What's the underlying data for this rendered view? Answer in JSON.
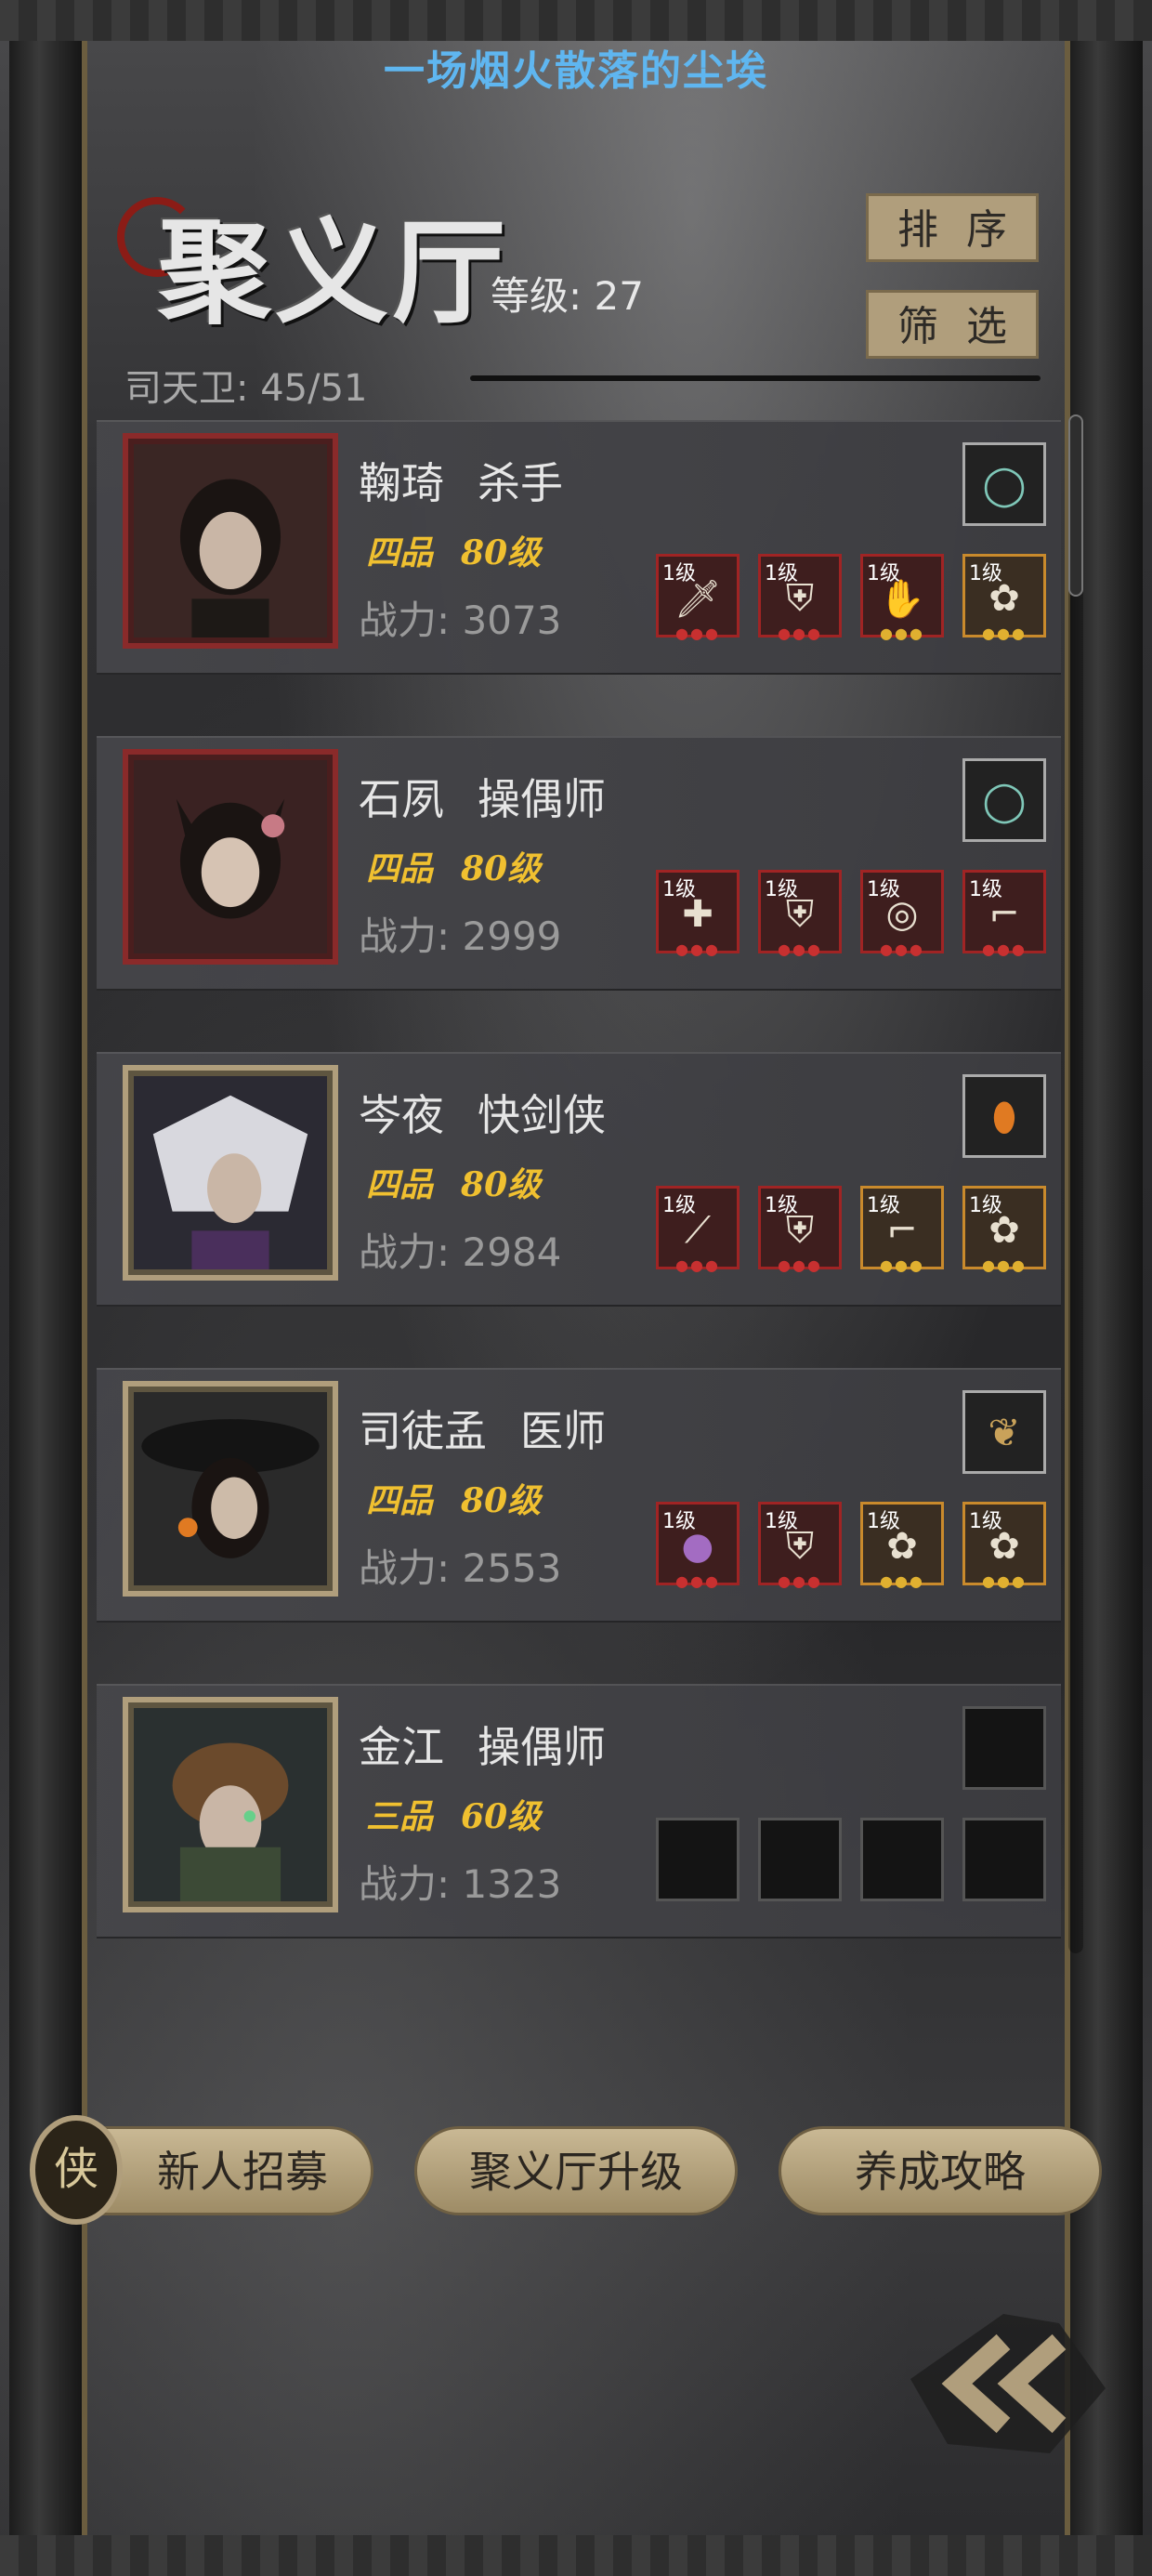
{
  "banner": "一场烟火散落的尘埃",
  "hall": {
    "title": "聚义厅",
    "level_text": "等级: 27",
    "guard_count": "司天卫: 45/51"
  },
  "buttons": {
    "sort": "排序",
    "filter": "筛选",
    "recruit": "新人招募",
    "upgrade": "聚义厅升级",
    "guide": "养成攻略"
  },
  "characters": [
    {
      "name": "鞠琦",
      "class": "杀手",
      "rank": "四品",
      "level": "80级",
      "power": "战力: 3073",
      "frame": "red",
      "equip_levels": [
        "1级",
        "1级",
        "1级",
        "1级"
      ]
    },
    {
      "name": "石夙",
      "class": "操偶师",
      "rank": "四品",
      "level": "80级",
      "power": "战力: 2999",
      "frame": "red",
      "equip_levels": [
        "1级",
        "1级",
        "1级",
        "1级"
      ]
    },
    {
      "name": "岑夜",
      "class": "快剑侠",
      "rank": "四品",
      "level": "80级",
      "power": "战力: 2984",
      "frame": "gold",
      "equip_levels": [
        "1级",
        "1级",
        "1级",
        "1级"
      ]
    },
    {
      "name": "司徒孟",
      "class": "医师",
      "rank": "四品",
      "level": "80级",
      "power": "战力: 2553",
      "frame": "gold",
      "equip_levels": [
        "1级",
        "1级",
        "1级",
        "1级"
      ]
    },
    {
      "name": "金江",
      "class": "操偶师",
      "rank": "三品",
      "level": "60级",
      "power": "战力: 1323",
      "frame": "gold",
      "equip_levels": [
        "",
        "",
        "",
        ""
      ]
    }
  ],
  "colors": {
    "banner": "#5fb6f0",
    "rank_text": "#f0c030",
    "button_face": "#b09e7c"
  }
}
